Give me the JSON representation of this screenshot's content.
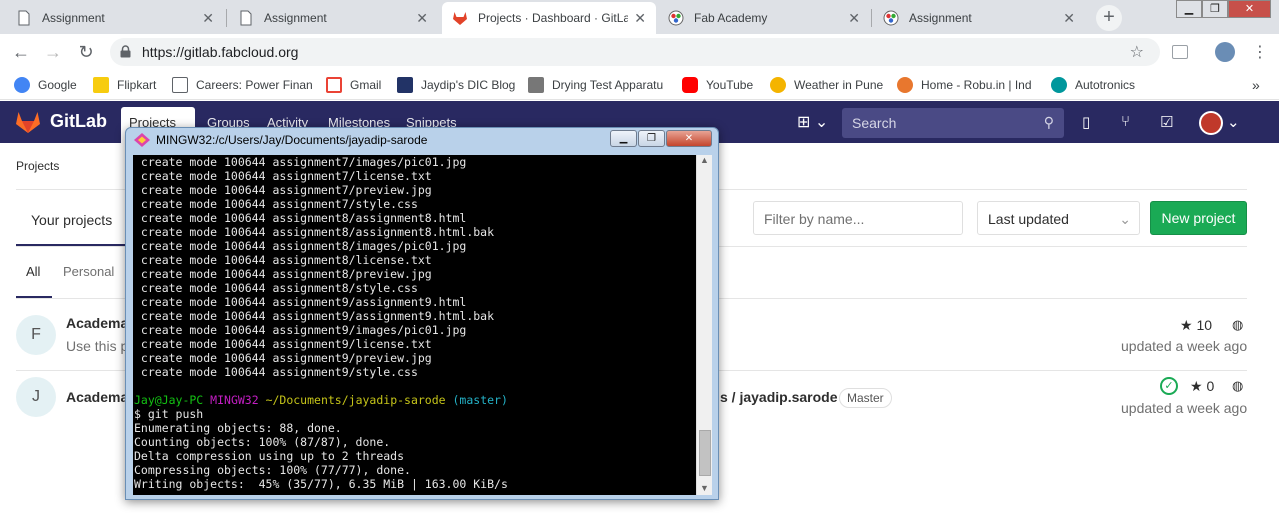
{
  "browser": {
    "tabs": [
      {
        "title": "Assignment",
        "icon": "document-icon"
      },
      {
        "title": "Assignment",
        "icon": "document-icon"
      },
      {
        "title": "Projects · Dashboard · GitLab",
        "icon": "gitlab-icon",
        "active": true
      },
      {
        "title": "Fab Academy",
        "icon": "fab-academy-icon"
      },
      {
        "title": "Assignment",
        "icon": "fab-academy-icon"
      }
    ],
    "url": "https://gitlab.fabcloud.org",
    "bookmarks": [
      {
        "label": "Google",
        "icon": "google-icon",
        "color": "#4285f4"
      },
      {
        "label": "Flipkart",
        "icon": "flipkart-icon",
        "color": "#f7cc0f"
      },
      {
        "label": "Careers: Power Finan",
        "icon": "document-icon",
        "color": "#ffffff"
      },
      {
        "label": "Gmail",
        "icon": "gmail-icon",
        "color": "#ea4335"
      },
      {
        "label": "Jaydip's DIC Blog",
        "icon": "blog-icon",
        "color": "#223366"
      },
      {
        "label": "Drying Test Apparatu",
        "icon": "apparatus-icon",
        "color": "#777777"
      },
      {
        "label": "YouTube",
        "icon": "youtube-icon",
        "color": "#ff0000"
      },
      {
        "label": "Weather in Pune",
        "icon": "weather-icon",
        "color": "#f4b400"
      },
      {
        "label": "Home - Robu.in | Ind",
        "icon": "robu-icon",
        "color": "#e8772e"
      },
      {
        "label": "Autotronics",
        "icon": "arduino-icon",
        "color": "#00979c"
      }
    ],
    "more": "»"
  },
  "gitlab": {
    "brand": "GitLab",
    "nav": [
      "Projects",
      "Groups",
      "Activity",
      "Milestones",
      "Snippets"
    ],
    "search_placeholder": "Search",
    "breadcrumb": "Projects",
    "tabs": [
      "Your projects"
    ],
    "subtabs": [
      "All",
      "Personal"
    ],
    "filter_placeholder": "Filter by name...",
    "sort": "Last updated",
    "new_project": "New project",
    "projects": [
      {
        "avatar": "F",
        "name": "Academa",
        "desc": "Use this p",
        "stars": "10",
        "updated": "updated a week ago"
      },
      {
        "avatar": "J",
        "name": "Academa",
        "path": "s / jayadip.sarode",
        "badge": "Master",
        "stars": "0",
        "updated": "updated a week ago"
      }
    ]
  },
  "terminal": {
    "title": "MINGW32:/c/Users/Jay/Documents/jayadip-sarode",
    "lines": [
      " create mode 100644 assignment7/images/pic01.jpg",
      " create mode 100644 assignment7/license.txt",
      " create mode 100644 assignment7/preview.jpg",
      " create mode 100644 assignment7/style.css",
      " create mode 100644 assignment8/assignment8.html",
      " create mode 100644 assignment8/assignment8.html.bak",
      " create mode 100644 assignment8/images/pic01.jpg",
      " create mode 100644 assignment8/license.txt",
      " create mode 100644 assignment8/preview.jpg",
      " create mode 100644 assignment8/style.css",
      " create mode 100644 assignment9/assignment9.html",
      " create mode 100644 assignment9/assignment9.html.bak",
      " create mode 100644 assignment9/images/pic01.jpg",
      " create mode 100644 assignment9/license.txt",
      " create mode 100644 assignment9/preview.jpg",
      " create mode 100644 assignment9/style.css",
      ""
    ],
    "prompt": {
      "user": "Jay@Jay-PC",
      "env": "MINGW32",
      "path": "~/Documents/jayadip-sarode",
      "branch": "(master)"
    },
    "command": "$ git push",
    "output": [
      "Enumerating objects: 88, done.",
      "Counting objects: 100% (87/87), done.",
      "Delta compression using up to 2 threads",
      "Compressing objects: 100% (77/77), done.",
      "Writing objects:  45% (35/77), 6.35 MiB | 163.00 KiB/s"
    ]
  }
}
